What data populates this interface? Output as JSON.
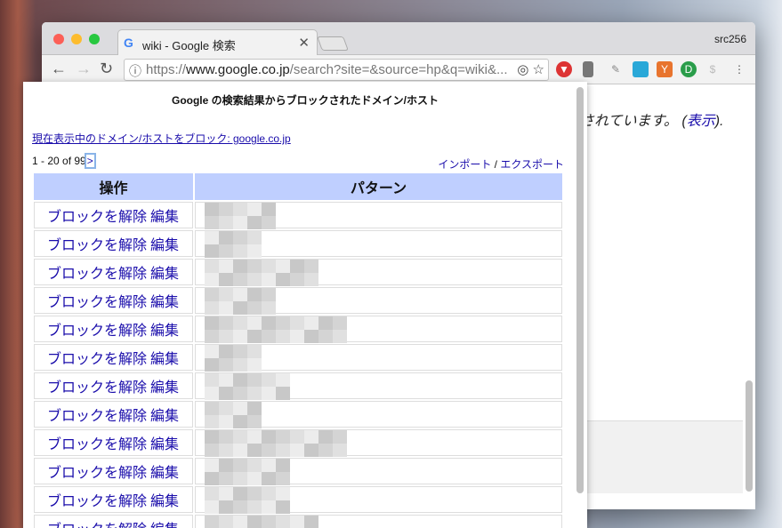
{
  "browser": {
    "tab_title": "wiki - Google 検索",
    "user": "src256",
    "url_prefix": "https://",
    "url_host": "www.google.co.jp",
    "url_path": "/search?site=&source=hp&q=wiki&..."
  },
  "page": {
    "text": "されています。 (",
    "link": "表示",
    "tail": ")."
  },
  "popup": {
    "title": "Google の検索結果からブロックされたドメイン/ホスト",
    "block_current": "現在表示中のドメイン/ホストをブロック: google.co.jp",
    "pager": "1 - 20 of 99",
    "next": ">",
    "import": "インポート",
    "sep": " / ",
    "export": "エクスポート",
    "headers": [
      "操作",
      "パターン"
    ],
    "unblock": "ブロックを解除",
    "edit": "編集",
    "row_count": 12
  }
}
